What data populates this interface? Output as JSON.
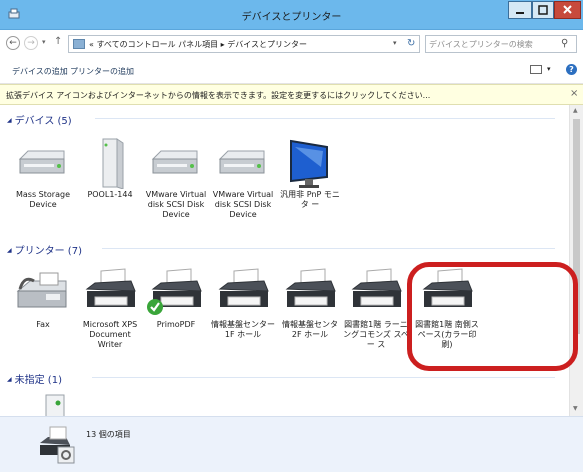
{
  "window": {
    "title": "デバイスとプリンター",
    "controls": {
      "minimize": "minimize",
      "maximize": "maximize",
      "close": "close"
    }
  },
  "address_bar": {
    "crumb_prefix": "«",
    "crumbs": [
      "すべてのコントロール パネル項目",
      "デバイスとプリンター"
    ],
    "separator": "▸",
    "search_placeholder": "デバイスとプリンターの検索"
  },
  "toolbar": {
    "add_device_label": "デバイスの追加",
    "add_printer_label": "プリンターの追加"
  },
  "infobar": {
    "message": "拡張デバイス アイコンおよびインターネットからの情報を表示できます。設定を変更するにはクリックしてください...",
    "close_glyph": "×"
  },
  "groups": {
    "devices": {
      "title": "デバイス (5)",
      "items": [
        {
          "label": "Mass Storage Device",
          "icon": "drive-icon"
        },
        {
          "label": "POOL1-144",
          "icon": "server-tower-icon"
        },
        {
          "label": "VMware Virtual disk SCSI Disk Device",
          "icon": "drive-icon"
        },
        {
          "label": "VMware Virtual disk SCSI Disk Device",
          "icon": "drive-icon"
        },
        {
          "label": "汎用非 PnP モニタ ー",
          "icon": "monitor-icon"
        }
      ]
    },
    "printers": {
      "title": "プリンター (7)",
      "items": [
        {
          "label": "Fax",
          "icon": "fax-icon"
        },
        {
          "label": "Microsoft XPS Document Writer",
          "icon": "printer-icon"
        },
        {
          "label": "PrimoPDF",
          "icon": "printer-default-icon"
        },
        {
          "label": "情報基盤センター 1F ホール",
          "icon": "printer-icon"
        },
        {
          "label": "情報基盤センタ 2F ホール",
          "icon": "printer-icon"
        },
        {
          "label": "図書館1階 ラーニ ングコモンズ スペー ス",
          "icon": "printer-icon"
        },
        {
          "label": "図書館1階 南側ス ペース(カラー印刷)",
          "icon": "printer-icon"
        }
      ]
    },
    "unspecified": {
      "title": "未指定 (1)"
    }
  },
  "status": {
    "item_count": "13 個の項目"
  },
  "colors": {
    "titlebar": "#6cb8ec",
    "group_header_text": "#1e3287",
    "infobar_bg": "#ffffe1",
    "highlight": "#cc1f1f",
    "statusbar_bg": "#ecf2fb"
  }
}
